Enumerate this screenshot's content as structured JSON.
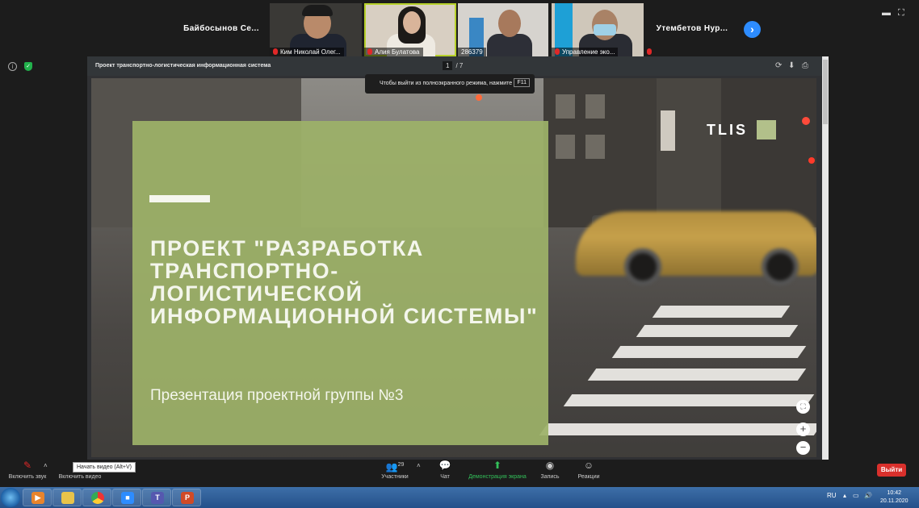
{
  "participants": {
    "tiles": [
      {
        "name": "Байбосынов Се...",
        "kind": "name"
      },
      {
        "caption": "Ким Николай Олег...",
        "kind": "video",
        "muted": true
      },
      {
        "caption": "Алия Булатова",
        "kind": "video",
        "muted": true,
        "highlighted": true
      },
      {
        "caption": "286379",
        "kind": "video",
        "muted": false
      },
      {
        "caption": "Управление эко...",
        "kind": "video",
        "muted": true
      },
      {
        "name": "Утембетов Нур...",
        "kind": "name"
      }
    ],
    "next_icon": "chevron-right-icon"
  },
  "viewer": {
    "doc_title": "Проект транспортно-логистическая информационная система",
    "page_current": "1",
    "page_sep": "/",
    "page_total": "7",
    "fullscreen_hint": "Чтобы выйти из полноэкранного режима, нажмите",
    "fullscreen_key": "F11"
  },
  "slide": {
    "title": "ПРОЕКТ \"РАЗРАБОТКА ТРАНСПОРТНО-ЛОГИСТИЧЕСКОЙ ИНФОРМАЦИОННОЙ СИСТЕМЫ\"",
    "subtitle": "Презентация проектной группы №3",
    "logo": "TLIS",
    "panel_color": "#9db268",
    "logo_square_color": "#b2c08a"
  },
  "toolbar": {
    "unmute_label": "Включить звук",
    "video_label": "Включить видео",
    "video_tooltip": "Начать видео (Alt+V)",
    "participants_label": "Участники",
    "participants_count": "29",
    "chat_label": "Чат",
    "share_label": "Демонстрация экрана",
    "record_label": "Запись",
    "reactions_label": "Реакции",
    "exit_label": "Выйти",
    "accent_green": "#33c05a",
    "exit_color": "#d9302c"
  },
  "taskbar": {
    "apps": [
      "media-player-icon",
      "folder-icon",
      "chrome-icon",
      "zoom-icon",
      "teams-icon",
      "powerpoint-icon"
    ],
    "lang": "RU",
    "time": "10:42",
    "date": "20.11.2020"
  }
}
